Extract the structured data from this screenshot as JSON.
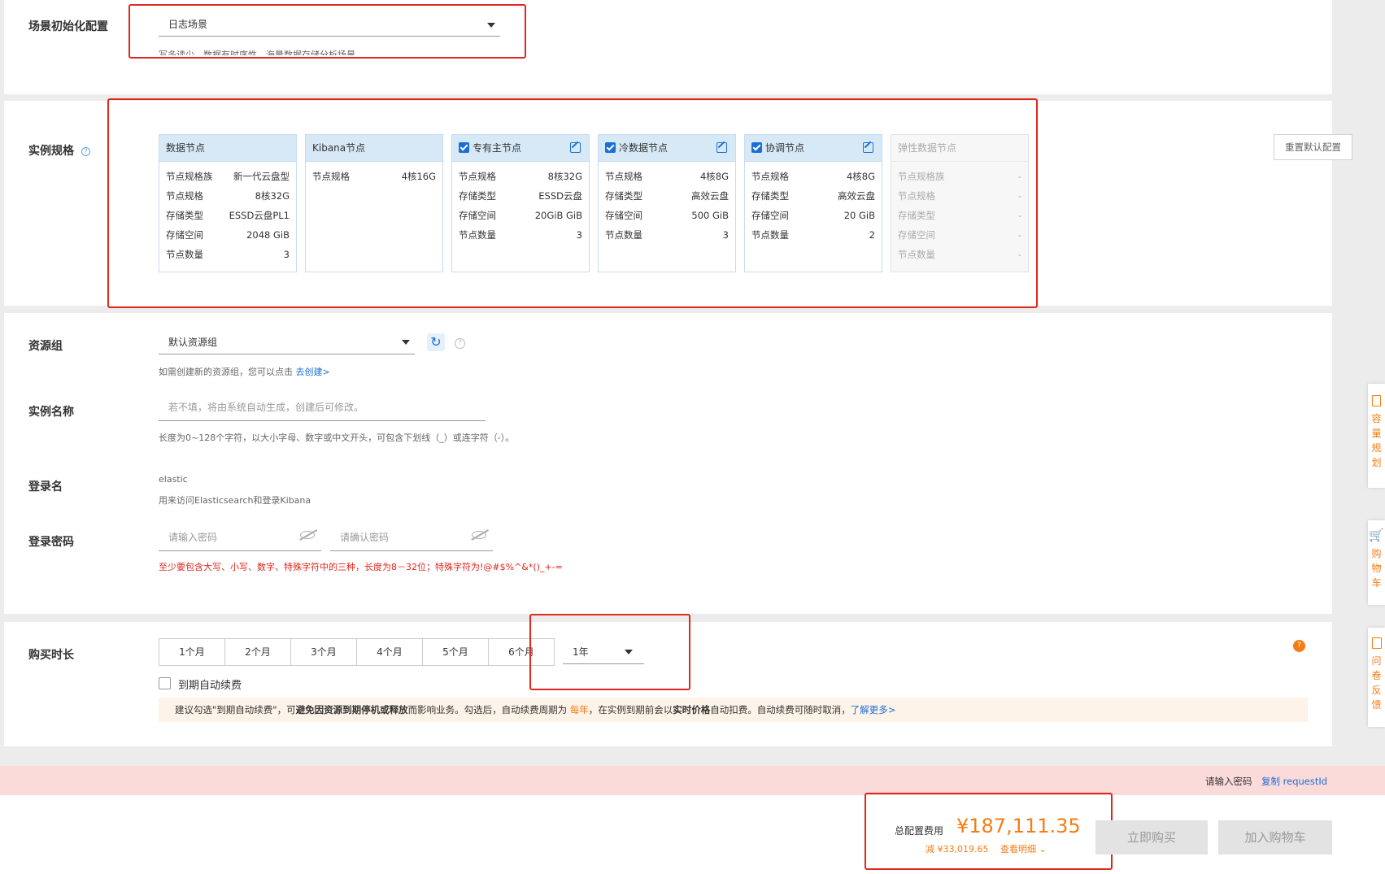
{
  "scene": {
    "label": "场景初始化配置",
    "selected": "日志场景",
    "hint": "写多读少、数据有时序性、海量数据存储分析场景"
  },
  "spec": {
    "label": "实例规格",
    "reset_button": "重置默认配置",
    "cards": [
      {
        "title": "数据节点",
        "checked": false,
        "rows": [
          {
            "k": "节点规格族",
            "v": "新一代云盘型"
          },
          {
            "k": "节点规格",
            "v": "8核32G"
          },
          {
            "k": "存储类型",
            "v": "ESSD云盘PL1"
          },
          {
            "k": "存储空间",
            "v": "2048 GiB"
          },
          {
            "k": "节点数量",
            "v": "3"
          }
        ]
      },
      {
        "title": "Kibana节点",
        "checked": false,
        "rows": [
          {
            "k": "节点规格",
            "v": "4核16G"
          }
        ]
      },
      {
        "title": "专有主节点",
        "checked": true,
        "rows": [
          {
            "k": "节点规格",
            "v": "8核32G"
          },
          {
            "k": "存储类型",
            "v": "ESSD云盘"
          },
          {
            "k": "存储空间",
            "v": "20GiB GiB"
          },
          {
            "k": "节点数量",
            "v": "3"
          }
        ]
      },
      {
        "title": "冷数据节点",
        "checked": true,
        "rows": [
          {
            "k": "节点规格",
            "v": "4核8G"
          },
          {
            "k": "存储类型",
            "v": "高效云盘"
          },
          {
            "k": "存储空间",
            "v": "500 GiB"
          },
          {
            "k": "节点数量",
            "v": "3"
          }
        ]
      },
      {
        "title": "协调节点",
        "checked": true,
        "rows": [
          {
            "k": "节点规格",
            "v": "4核8G"
          },
          {
            "k": "存储类型",
            "v": "高效云盘"
          },
          {
            "k": "存储空间",
            "v": "20 GiB"
          },
          {
            "k": "节点数量",
            "v": "2"
          }
        ]
      },
      {
        "title": "弹性数据节点",
        "checked": false,
        "rows": [
          {
            "k": "节点规格族",
            "v": "-"
          },
          {
            "k": "节点规格",
            "v": "-"
          },
          {
            "k": "存储类型",
            "v": "-"
          },
          {
            "k": "存储空间",
            "v": "-"
          },
          {
            "k": "节点数量",
            "v": "-"
          }
        ]
      }
    ]
  },
  "resource_group": {
    "label": "资源组",
    "selected": "默认资源组",
    "hint_prefix": "如需创建新的资源组，您可以点击",
    "hint_link": "去创建>"
  },
  "instance_name": {
    "label": "实例名称",
    "placeholder": "若不填，将由系统自动生成，创建后可修改。",
    "hint": "长度为0~128个字符，以大小字母、数字或中文开头，可包含下划线（_）或连字符（-）。"
  },
  "login_name": {
    "label": "登录名",
    "value": "elastic",
    "hint": "用来访问Elasticsearch和登录Kibana"
  },
  "login_password": {
    "label": "登录密码",
    "placeholder": "请输入密码",
    "confirm_placeholder": "请确认密码",
    "error": "至少要包含大写、小写、数字、特殊字符中的三种，长度为8－32位；特殊字符为!@#$%^&*()_+-="
  },
  "duration": {
    "label": "购买时长",
    "options": [
      "1个月",
      "2个月",
      "3个月",
      "4个月",
      "5个月",
      "6个月"
    ],
    "selected": "1年",
    "auto_renew": "到期自动续费",
    "notice": {
      "p1": "建议勾选\"到期自动续费\"，可",
      "b1": "避免因资源到期停机或释放",
      "p2": "而影响业务。勾选后，自动续费周期为 ",
      "o1": "每年",
      "p3": "，在实例到期前会以",
      "b2": "实时价格",
      "p4": "自动扣费。自动续费可随时取消，",
      "link": "了解更多>"
    }
  },
  "error_bar": {
    "text": "请输入密码",
    "link": "复制 requestId"
  },
  "footer": {
    "total_label": "总配置费用",
    "price": "¥187,111.35",
    "discount": "减 ¥33,019.65",
    "detail_link": "查看明细",
    "buy_button": "立即购买",
    "cart_button": "加入购物车"
  },
  "side_tabs": [
    {
      "icon": "document-icon",
      "text": "容量规划"
    },
    {
      "icon": "cart-icon",
      "text": "购物车"
    },
    {
      "icon": "survey-icon",
      "text": "问卷反馈"
    }
  ],
  "colors": {
    "accent": "#1a6fd6",
    "price": "#f57c14",
    "error": "#e0261d",
    "highlight_box": "#e0261d"
  }
}
